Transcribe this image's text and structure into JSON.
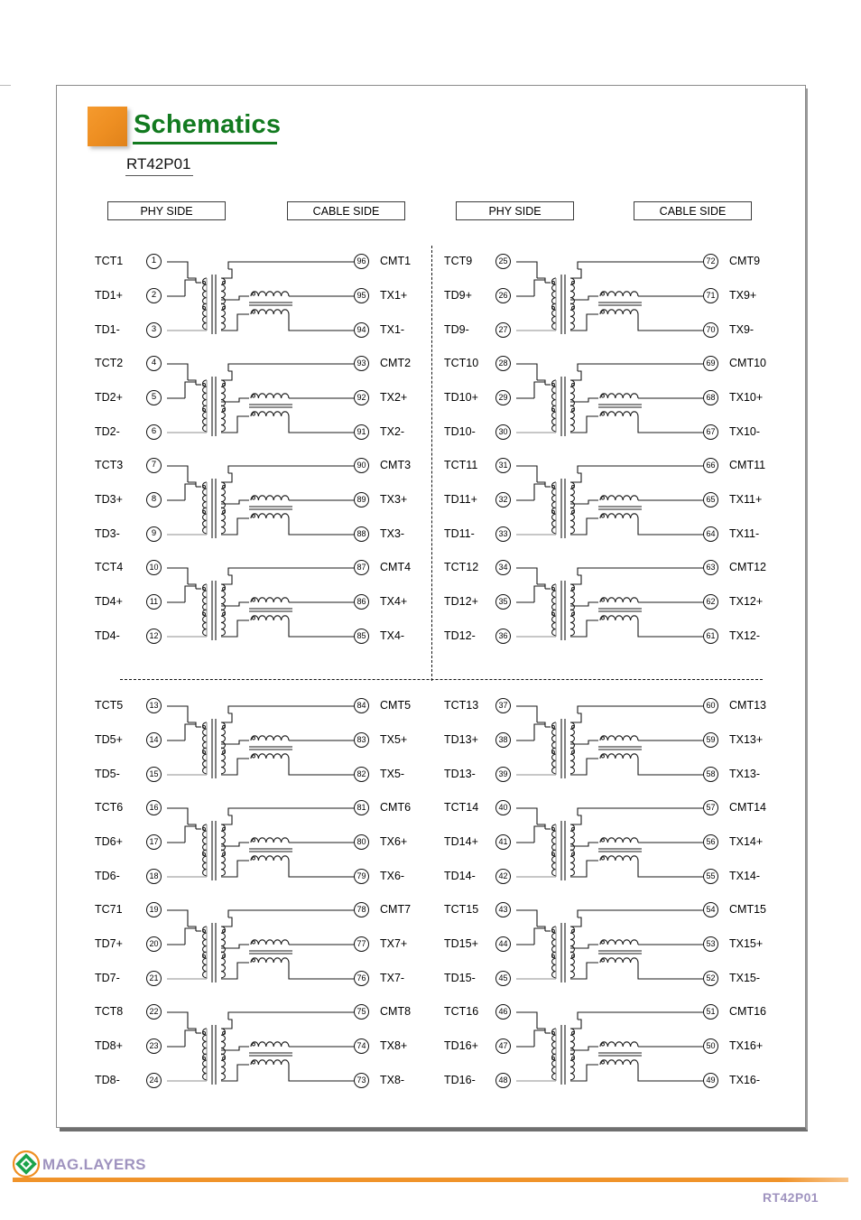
{
  "page": {
    "title": "Schematics",
    "part_number": "RT42P01",
    "footer_part_number": "RT42P01",
    "footer_brand": "MAG.LAYERS",
    "accent_orange": "#ee8f22",
    "title_green": "#127a1f",
    "footer_purple": "#9f93bf",
    "logo_green": "#1aa34a"
  },
  "side_headers": [
    {
      "label": "PHY SIDE",
      "name": "phy-side-header-1"
    },
    {
      "label": "CABLE SIDE",
      "name": "cable-side-header-1"
    },
    {
      "label": "PHY SIDE",
      "name": "phy-side-header-2"
    },
    {
      "label": "CABLE SIDE",
      "name": "cable-side-header-2"
    }
  ],
  "channels": [
    {
      "quadrant": "top-left",
      "index": 1,
      "phy": [
        {
          "label": "TCT1",
          "pin": "1"
        },
        {
          "label": "TD1+",
          "pin": "2"
        },
        {
          "label": "TD1-",
          "pin": "3"
        }
      ],
      "cable": [
        {
          "label": "CMT1",
          "pin": "96"
        },
        {
          "label": "TX1+",
          "pin": "95"
        },
        {
          "label": "TX1-",
          "pin": "94"
        }
      ]
    },
    {
      "quadrant": "top-left",
      "index": 2,
      "phy": [
        {
          "label": "TCT2",
          "pin": "4"
        },
        {
          "label": "TD2+",
          "pin": "5"
        },
        {
          "label": "TD2-",
          "pin": "6"
        }
      ],
      "cable": [
        {
          "label": "CMT2",
          "pin": "93"
        },
        {
          "label": "TX2+",
          "pin": "92"
        },
        {
          "label": "TX2-",
          "pin": "91"
        }
      ]
    },
    {
      "quadrant": "top-left",
      "index": 3,
      "phy": [
        {
          "label": "TCT3",
          "pin": "7"
        },
        {
          "label": "TD3+",
          "pin": "8"
        },
        {
          "label": "TD3-",
          "pin": "9"
        }
      ],
      "cable": [
        {
          "label": "CMT3",
          "pin": "90"
        },
        {
          "label": "TX3+",
          "pin": "89"
        },
        {
          "label": "TX3-",
          "pin": "88"
        }
      ]
    },
    {
      "quadrant": "top-left",
      "index": 4,
      "phy": [
        {
          "label": "TCT4",
          "pin": "10"
        },
        {
          "label": "TD4+",
          "pin": "11"
        },
        {
          "label": "TD4-",
          "pin": "12"
        }
      ],
      "cable": [
        {
          "label": "CMT4",
          "pin": "87"
        },
        {
          "label": "TX4+",
          "pin": "86"
        },
        {
          "label": "TX4-",
          "pin": "85"
        }
      ]
    },
    {
      "quadrant": "top-right",
      "index": 9,
      "phy": [
        {
          "label": "TCT9",
          "pin": "25"
        },
        {
          "label": "TD9+",
          "pin": "26"
        },
        {
          "label": "TD9-",
          "pin": "27"
        }
      ],
      "cable": [
        {
          "label": "CMT9",
          "pin": "72"
        },
        {
          "label": "TX9+",
          "pin": "71"
        },
        {
          "label": "TX9-",
          "pin": "70"
        }
      ]
    },
    {
      "quadrant": "top-right",
      "index": 10,
      "phy": [
        {
          "label": "TCT10",
          "pin": "28"
        },
        {
          "label": "TD10+",
          "pin": "29"
        },
        {
          "label": "TD10-",
          "pin": "30"
        }
      ],
      "cable": [
        {
          "label": "CMT10",
          "pin": "69"
        },
        {
          "label": "TX10+",
          "pin": "68"
        },
        {
          "label": "TX10-",
          "pin": "67"
        }
      ]
    },
    {
      "quadrant": "top-right",
      "index": 11,
      "phy": [
        {
          "label": "TCT11",
          "pin": "31"
        },
        {
          "label": "TD11+",
          "pin": "32"
        },
        {
          "label": "TD11-",
          "pin": "33"
        }
      ],
      "cable": [
        {
          "label": "CMT11",
          "pin": "66"
        },
        {
          "label": "TX11+",
          "pin": "65"
        },
        {
          "label": "TX11-",
          "pin": "64"
        }
      ]
    },
    {
      "quadrant": "top-right",
      "index": 12,
      "phy": [
        {
          "label": "TCT12",
          "pin": "34"
        },
        {
          "label": "TD12+",
          "pin": "35"
        },
        {
          "label": "TD12-",
          "pin": "36"
        }
      ],
      "cable": [
        {
          "label": "CMT12",
          "pin": "63"
        },
        {
          "label": "TX12+",
          "pin": "62"
        },
        {
          "label": "TX12-",
          "pin": "61"
        }
      ]
    },
    {
      "quadrant": "bottom-left",
      "index": 5,
      "phy": [
        {
          "label": "TCT5",
          "pin": "13"
        },
        {
          "label": "TD5+",
          "pin": "14"
        },
        {
          "label": "TD5-",
          "pin": "15"
        }
      ],
      "cable": [
        {
          "label": "CMT5",
          "pin": "84"
        },
        {
          "label": "TX5+",
          "pin": "83"
        },
        {
          "label": "TX5-",
          "pin": "82"
        }
      ]
    },
    {
      "quadrant": "bottom-left",
      "index": 6,
      "phy": [
        {
          "label": "TCT6",
          "pin": "16"
        },
        {
          "label": "TD6+",
          "pin": "17"
        },
        {
          "label": "TD6-",
          "pin": "18"
        }
      ],
      "cable": [
        {
          "label": "CMT6",
          "pin": "81"
        },
        {
          "label": "TX6+",
          "pin": "80"
        },
        {
          "label": "TX6-",
          "pin": "79"
        }
      ]
    },
    {
      "quadrant": "bottom-left",
      "index": 7,
      "phy": [
        {
          "label": "TC71",
          "pin": "19"
        },
        {
          "label": "TD7+",
          "pin": "20"
        },
        {
          "label": "TD7-",
          "pin": "21"
        }
      ],
      "cable": [
        {
          "label": "CMT7",
          "pin": "78"
        },
        {
          "label": "TX7+",
          "pin": "77"
        },
        {
          "label": "TX7-",
          "pin": "76"
        }
      ]
    },
    {
      "quadrant": "bottom-left",
      "index": 8,
      "phy": [
        {
          "label": "TCT8",
          "pin": "22"
        },
        {
          "label": "TD8+",
          "pin": "23"
        },
        {
          "label": "TD8-",
          "pin": "24"
        }
      ],
      "cable": [
        {
          "label": "CMT8",
          "pin": "75"
        },
        {
          "label": "TX8+",
          "pin": "74"
        },
        {
          "label": "TX8-",
          "pin": "73"
        }
      ]
    },
    {
      "quadrant": "bottom-right",
      "index": 13,
      "phy": [
        {
          "label": "TCT13",
          "pin": "37"
        },
        {
          "label": "TD13+",
          "pin": "38"
        },
        {
          "label": "TD13-",
          "pin": "39"
        }
      ],
      "cable": [
        {
          "label": "CMT13",
          "pin": "60"
        },
        {
          "label": "TX13+",
          "pin": "59"
        },
        {
          "label": "TX13-",
          "pin": "58"
        }
      ]
    },
    {
      "quadrant": "bottom-right",
      "index": 14,
      "phy": [
        {
          "label": "TCT14",
          "pin": "40"
        },
        {
          "label": "TD14+",
          "pin": "41"
        },
        {
          "label": "TD14-",
          "pin": "42"
        }
      ],
      "cable": [
        {
          "label": "CMT14",
          "pin": "57"
        },
        {
          "label": "TX14+",
          "pin": "56"
        },
        {
          "label": "TX14-",
          "pin": "55"
        }
      ]
    },
    {
      "quadrant": "bottom-right",
      "index": 15,
      "phy": [
        {
          "label": "TCT15",
          "pin": "43"
        },
        {
          "label": "TD15+",
          "pin": "44"
        },
        {
          "label": "TD15-",
          "pin": "45"
        }
      ],
      "cable": [
        {
          "label": "CMT15",
          "pin": "54"
        },
        {
          "label": "TX15+",
          "pin": "53"
        },
        {
          "label": "TX15-",
          "pin": "52"
        }
      ]
    },
    {
      "quadrant": "bottom-right",
      "index": 16,
      "phy": [
        {
          "label": "TCT16",
          "pin": "46"
        },
        {
          "label": "TD16+",
          "pin": "47"
        },
        {
          "label": "TD16-",
          "pin": "48"
        }
      ],
      "cable": [
        {
          "label": "CMT16",
          "pin": "51"
        },
        {
          "label": "TX16+",
          "pin": "50"
        },
        {
          "label": "TX16-",
          "pin": "49"
        }
      ]
    }
  ]
}
